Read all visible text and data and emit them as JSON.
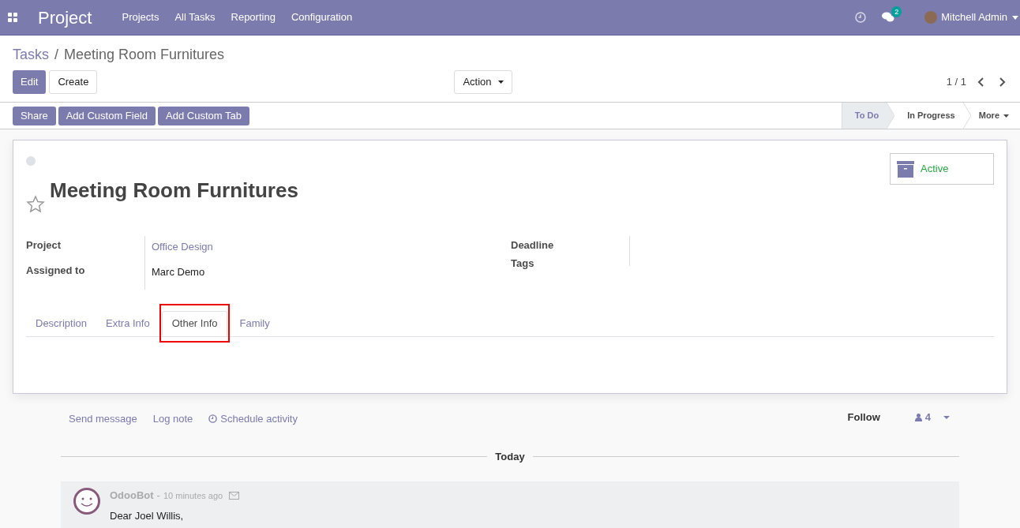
{
  "navbar": {
    "app_title": "Project",
    "menu": [
      "Projects",
      "All Tasks",
      "Reporting",
      "Configuration"
    ],
    "messages_count": "2",
    "user": "Mitchell Admin"
  },
  "breadcrumb": {
    "parent": "Tasks",
    "separator": "/",
    "current": "Meeting Room Furnitures"
  },
  "buttons": {
    "edit": "Edit",
    "create": "Create",
    "action": "Action"
  },
  "pager": "1 / 1",
  "action_buttons": [
    "Share",
    "Add Custom Field",
    "Add Custom Tab"
  ],
  "stages": [
    {
      "label": "To Do",
      "selected": true
    },
    {
      "label": "In Progress",
      "selected": false
    }
  ],
  "stages_more": "More",
  "record": {
    "title": "Meeting Room Furnitures",
    "starred": false,
    "active_label": "Active",
    "left_fields": [
      {
        "label": "Project",
        "value": "Office Design",
        "kind": "link"
      },
      {
        "label": "Assigned to",
        "value": "Marc Demo",
        "kind": "text"
      }
    ],
    "right_fields": [
      {
        "label": "Deadline"
      },
      {
        "label": "Tags"
      }
    ]
  },
  "tabs": [
    {
      "label": "Description",
      "selected": false,
      "highlighted": false
    },
    {
      "label": "Extra Info",
      "selected": false,
      "highlighted": false
    },
    {
      "label": "Other Info",
      "selected": true,
      "highlighted": true
    },
    {
      "label": "Family",
      "selected": false,
      "highlighted": false
    }
  ],
  "chatter": {
    "send_message": "Send message",
    "log_note": "Log note",
    "schedule_activity": "Schedule activity",
    "follow": "Follow",
    "followers": "4",
    "day_separator": "Today",
    "message": {
      "author": "OdooBot",
      "separator": "-",
      "time": "10 minutes ago",
      "body": "Dear Joel Willis,"
    }
  }
}
